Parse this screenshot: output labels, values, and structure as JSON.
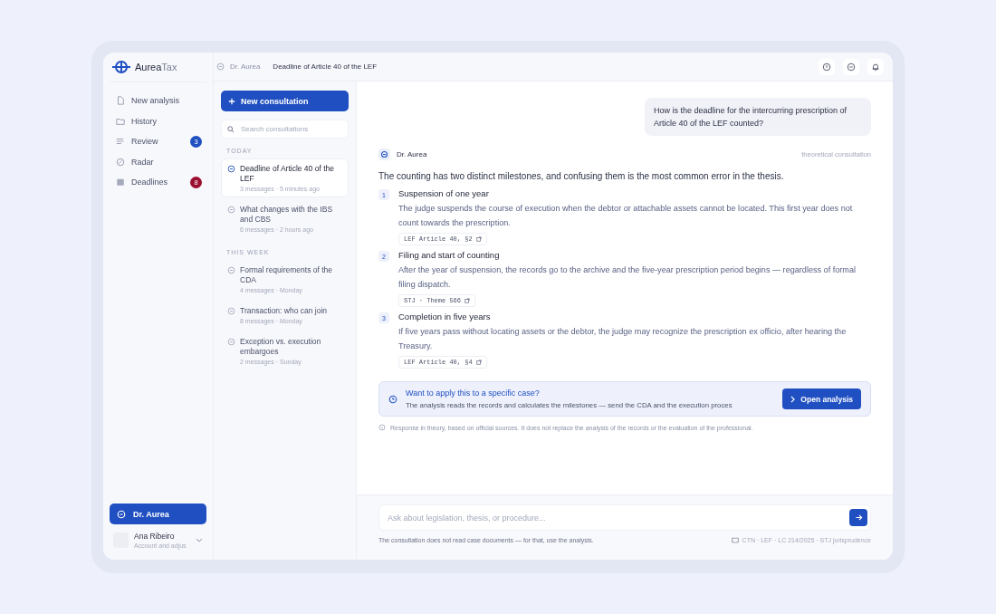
{
  "brand": {
    "name_a": "Aurea",
    "name_b": "Tax"
  },
  "breadcrumb": {
    "assistant": "Dr. Aurea",
    "title": "Deadline of Article 40 of the LEF"
  },
  "sidebar": {
    "items": [
      {
        "label": "New analysis",
        "kind": "file",
        "selected": false
      },
      {
        "label": "History",
        "kind": "folder",
        "selected": false
      },
      {
        "label": "Review",
        "kind": "list",
        "badge": {
          "text": "3",
          "color": "#1f4fc1"
        },
        "selected": false
      },
      {
        "label": "Radar",
        "kind": "radar",
        "selected": false
      },
      {
        "label": "Deadlines",
        "kind": "calendar",
        "badge": {
          "text": "8",
          "color": "#9b1030"
        },
        "selected": false
      }
    ],
    "assistant_button": {
      "label": "Dr. Aurea",
      "selected": true
    },
    "user": {
      "name": "Ana Ribeiro",
      "subtitle": "Account and adjus"
    }
  },
  "consultations": {
    "new_button": "New consultation",
    "search": {
      "placeholder": "Search consultations"
    },
    "groups": [
      {
        "label": "TODAY",
        "items": [
          {
            "title": "Deadline of Article 40 of the LEF",
            "meta": "3 messages · 5 minutes ago",
            "selected": true
          },
          {
            "title": "What changes with the IBS and CBS",
            "meta": "6 messages · 2 hours ago",
            "selected": false
          }
        ]
      },
      {
        "label": "THIS WEEK",
        "items": [
          {
            "title": "Formal requirements of the CDA",
            "meta": "4 messages · Monday",
            "selected": false
          },
          {
            "title": "Transaction: who can join",
            "meta": "8 messages · Monday",
            "selected": false
          },
          {
            "title": "Exception vs. execution embargoes",
            "meta": "2 messages · Sunday",
            "selected": false
          }
        ]
      }
    ]
  },
  "chat": {
    "question": "How is the deadline for the intercurring prescription of Article 40 of the LEF counted?",
    "answer": {
      "author": "Dr. Aurea",
      "tag": "theoretical consultation",
      "intro": "The counting has two distinct milestones, and confusing them is the most common error in the thesis.",
      "steps": [
        {
          "number": "1",
          "title": "Suspension of one year",
          "text": "The judge suspends the course of execution when the debtor or attachable assets cannot be located. This first year does not count towards the prescription.",
          "source": "LEF Article 40, §2"
        },
        {
          "number": "2",
          "title": "Filing and start of counting",
          "text": "After the year of suspension, the records go to the archive and the five-year prescription period begins — regardless of formal filing dispatch.",
          "source": "STJ · Theme 566"
        },
        {
          "number": "3",
          "title": "Completion in five years",
          "text": "If five years pass without locating assets or the debtor, the judge may recognize the prescription ex officio, after hearing the Treasury.",
          "source": "LEF Article 40, §4"
        }
      ],
      "callout": {
        "title": "Want to apply this to a specific case?",
        "text": "The analysis reads the records and calculates the milestones — send the CDA and the execution proces",
        "button": "Open analysis"
      },
      "disclaimer": "Response in theory, based on official sources. It does not replace the analysis of the records or the evaluation of the professional."
    },
    "composer": {
      "placeholder": "Ask about legislation, thesis, or procedure...",
      "note": "The consultation does not read case documents — for that, use the analysis.",
      "sources": "CTN · LEF · LC 214/2025 · STJ jurisprudence"
    }
  }
}
